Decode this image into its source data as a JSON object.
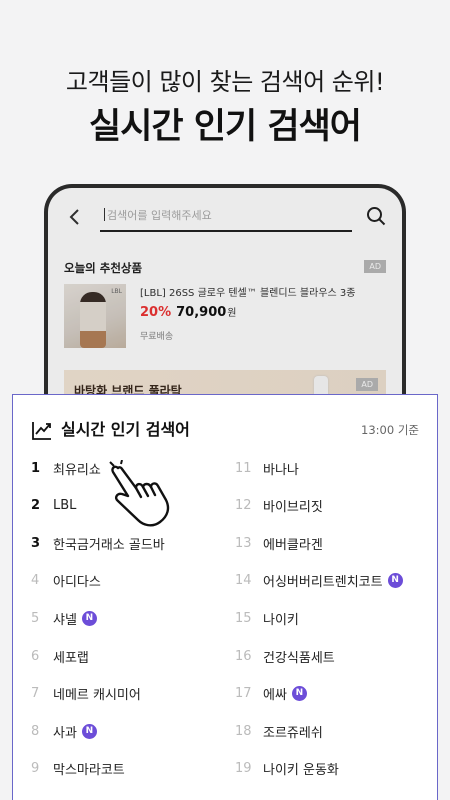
{
  "promo": {
    "headline": "고객들이 많이 찾는 검색어 순위!",
    "title": "실시간 인기 검색어"
  },
  "phone": {
    "search_placeholder": "검색어를 입력해주세요",
    "back_icon": "back-arrow-icon",
    "search_icon": "search-icon",
    "recommended_title": "오늘의 추천상품",
    "ad_label": "AD",
    "product": {
      "image_tag": "LBL",
      "name": "[LBL] 26SS 글로우 텐셀™ 블렌디드 블라우스 3종",
      "discount": "20%",
      "price": "70,900",
      "currency": "원",
      "shipping": "무료배송"
    },
    "banner_text": "바탕화 브랜드 풀라탁"
  },
  "ranking": {
    "title": "실시간 인기 검색어",
    "time": "13:00 기준",
    "new_label": "N",
    "accent_color": "#6c4dd8",
    "left": [
      {
        "rank": "1",
        "term": "최유리쇼",
        "is_new": false
      },
      {
        "rank": "2",
        "term": "LBL",
        "is_new": false
      },
      {
        "rank": "3",
        "term": "한국금거래소 골드바",
        "is_new": false
      },
      {
        "rank": "4",
        "term": "아디다스",
        "is_new": false
      },
      {
        "rank": "5",
        "term": "샤넬",
        "is_new": true
      },
      {
        "rank": "6",
        "term": "세포랩",
        "is_new": false
      },
      {
        "rank": "7",
        "term": "네메르 캐시미어",
        "is_new": false
      },
      {
        "rank": "8",
        "term": "사과",
        "is_new": true
      },
      {
        "rank": "9",
        "term": "막스마라코트",
        "is_new": false
      }
    ],
    "right": [
      {
        "rank": "11",
        "term": "바나나",
        "is_new": false
      },
      {
        "rank": "12",
        "term": "바이브리짓",
        "is_new": false
      },
      {
        "rank": "13",
        "term": "에버클라겐",
        "is_new": false
      },
      {
        "rank": "14",
        "term": "어싱버버리트렌치코트",
        "is_new": true
      },
      {
        "rank": "15",
        "term": "나이키",
        "is_new": false
      },
      {
        "rank": "16",
        "term": "건강식품세트",
        "is_new": false
      },
      {
        "rank": "17",
        "term": "에싸",
        "is_new": true
      },
      {
        "rank": "18",
        "term": "조르쥬레쉬",
        "is_new": false
      },
      {
        "rank": "19",
        "term": "나이키 운동화",
        "is_new": false
      }
    ]
  }
}
